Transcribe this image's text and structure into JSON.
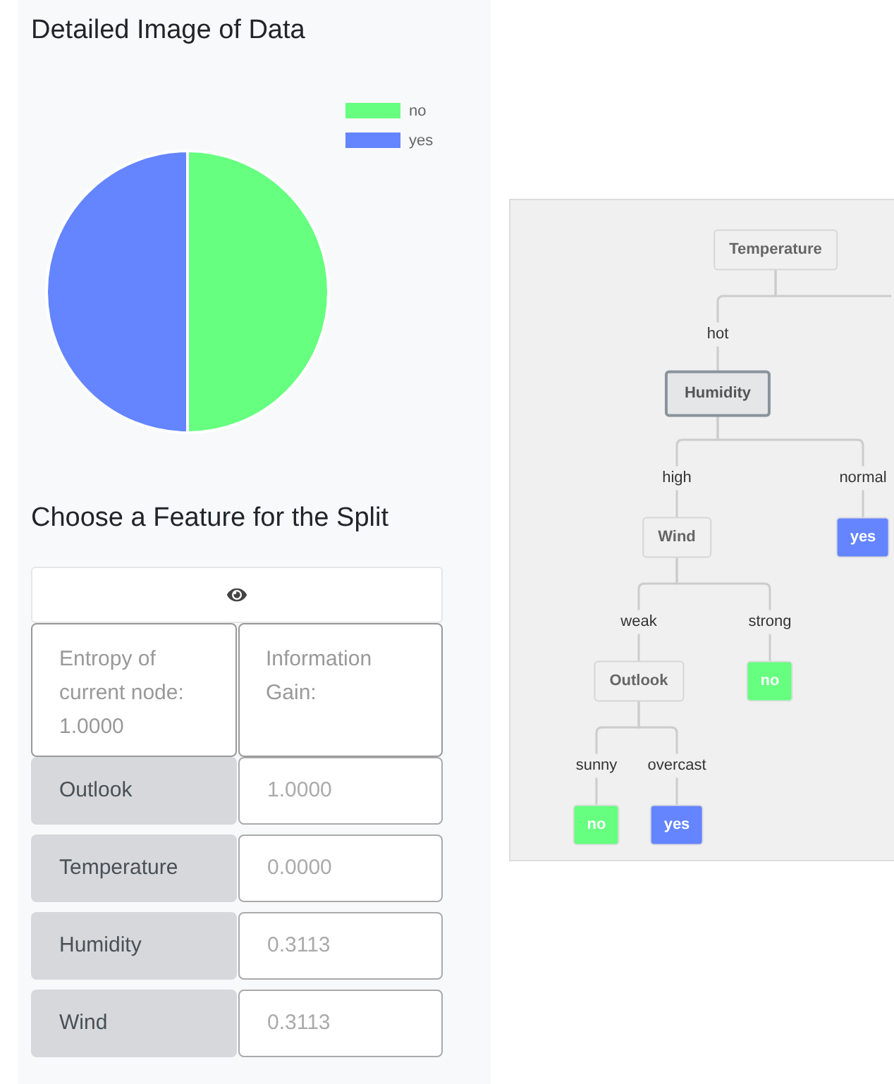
{
  "data_panel": {
    "title": "Detailed Image of Data",
    "chart_data": {
      "type": "pie",
      "categories": [
        "no",
        "yes"
      ],
      "values": [
        0.5,
        0.5
      ],
      "colors": [
        "#66ff80",
        "#6485ff"
      ],
      "legend": "top-right"
    },
    "split_title": "Choose a Feature for the Split",
    "table": {
      "header": [
        "Entropy of current node: 1.0000",
        "Information Gain:"
      ],
      "rows": [
        {
          "feature": "Outlook",
          "gain": "1.0000"
        },
        {
          "feature": "Temperature",
          "gain": "0.0000"
        },
        {
          "feature": "Humidity",
          "gain": "0.3113"
        },
        {
          "feature": "Wind",
          "gain": "0.3113"
        }
      ]
    }
  },
  "tree": {
    "label": "Temperature",
    "kind": "feature",
    "selected": false,
    "cut_off_branch": true,
    "children": [
      {
        "branch": "hot",
        "label": "Humidity",
        "kind": "feature",
        "selected": true,
        "children": [
          {
            "branch": "high",
            "label": "Wind",
            "kind": "feature",
            "selected": false,
            "children": [
              {
                "branch": "weak",
                "label": "Outlook",
                "kind": "feature",
                "selected": false,
                "children": [
                  {
                    "branch": "sunny",
                    "label": "no",
                    "kind": "leaf",
                    "color": "#66ff80"
                  },
                  {
                    "branch": "overcast",
                    "label": "yes",
                    "kind": "leaf",
                    "color": "#6485ff"
                  }
                ]
              },
              {
                "branch": "strong",
                "label": "no",
                "kind": "leaf",
                "color": "#66ff80"
              }
            ]
          },
          {
            "branch": "normal",
            "label": "yes",
            "kind": "leaf",
            "color": "#6485ff"
          }
        ]
      }
    ]
  }
}
